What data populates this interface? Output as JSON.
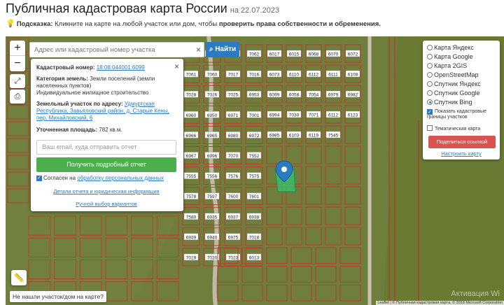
{
  "header": {
    "title": "Публичная кадастровая карта России",
    "date": "на 22.07.2023",
    "hint_prefix": "Подсказка:",
    "hint_text": " Кликните на карте на любой участок или дом, чтобы ",
    "hint_bold": "проверить права собственности и обременения."
  },
  "map_controls": {
    "zoom_in": "+",
    "zoom_out": "−",
    "search_placeholder": "Адрес или кадастровый номер участка",
    "search_value": "",
    "search_clear": "×",
    "find_button": "Найти",
    "not_found": "Не нашли участок/дом на карте?"
  },
  "popup": {
    "close": "×",
    "cadastral_label": "Кадастровый номер:",
    "cadastral_value": "18:08:044001:6099",
    "category_label": "Категория земель:",
    "category_value": "Земли поселений (земли населенных пунктов)",
    "usage_value": "Индивидуальное жилищное строительство",
    "address_label": "Земельный участок по адресу:",
    "address_value": "Удмуртская Республика, Завьяловский район, д. Старые Кены, пер. Михайловский, 6",
    "area_label": "Уточненная площадь:",
    "area_value": "782 кв.м.",
    "email_placeholder": "Ваш email, куда отправить отчет",
    "get_report_button": "Получить подробный отчет",
    "consent_text": "Согласен на ",
    "consent_link": "обработку персональных данных",
    "details_link": "Детали отчета и юридическая информация",
    "manual_link": "Ручной выбор вариантов"
  },
  "layers": {
    "options": [
      {
        "label": "Карта Яндекс",
        "selected": false
      },
      {
        "label": "Карта Google",
        "selected": false
      },
      {
        "label": "Карта 2GIS",
        "selected": false
      },
      {
        "label": "OpenStreetMap",
        "selected": false
      },
      {
        "label": "Спутник Яндекс",
        "selected": false
      },
      {
        "label": "Спутник Google",
        "selected": false
      },
      {
        "label": "Спутник Bing",
        "selected": true
      }
    ],
    "show_borders": "Показать кадастровые границы участков",
    "thematic_map": "Тематическая карта",
    "share_button": "Поделиться ссылкой",
    "setup_link": "Настроить карту"
  },
  "map_labels": [
    "6732",
    "7067",
    "7063",
    "7062",
    "7061",
    "7060",
    "7017",
    "7016",
    "7028",
    "7026",
    "7025",
    "6953",
    "6960",
    "6950",
    "6971",
    "7001",
    "6966",
    "6965",
    "6980",
    "6972",
    "6967",
    "6996",
    "7070",
    "7552",
    "7555",
    "7556",
    "7576",
    "7575",
    "7578",
    "7597",
    "7600",
    "7601",
    "7580",
    "6935",
    "6937",
    "6938",
    "6939",
    "6940",
    "6975",
    "7018",
    "7019",
    "7020",
    "7023",
    "6013",
    "6017",
    "6015",
    "6068",
    "6070",
    "6072",
    "6073",
    "6110",
    "6112",
    "6111",
    "6108",
    "6099",
    "6058",
    "7054",
    "6979",
    "6982",
    "6994",
    "7030",
    "7071",
    "6112",
    "6123",
    "6985",
    "6103",
    "6119",
    "7545"
  ],
  "watermark": "Активация Wi",
  "attribution": "Leaflet | © Публичная кадастровая карта, © 2018 Microsoft Corporation"
}
